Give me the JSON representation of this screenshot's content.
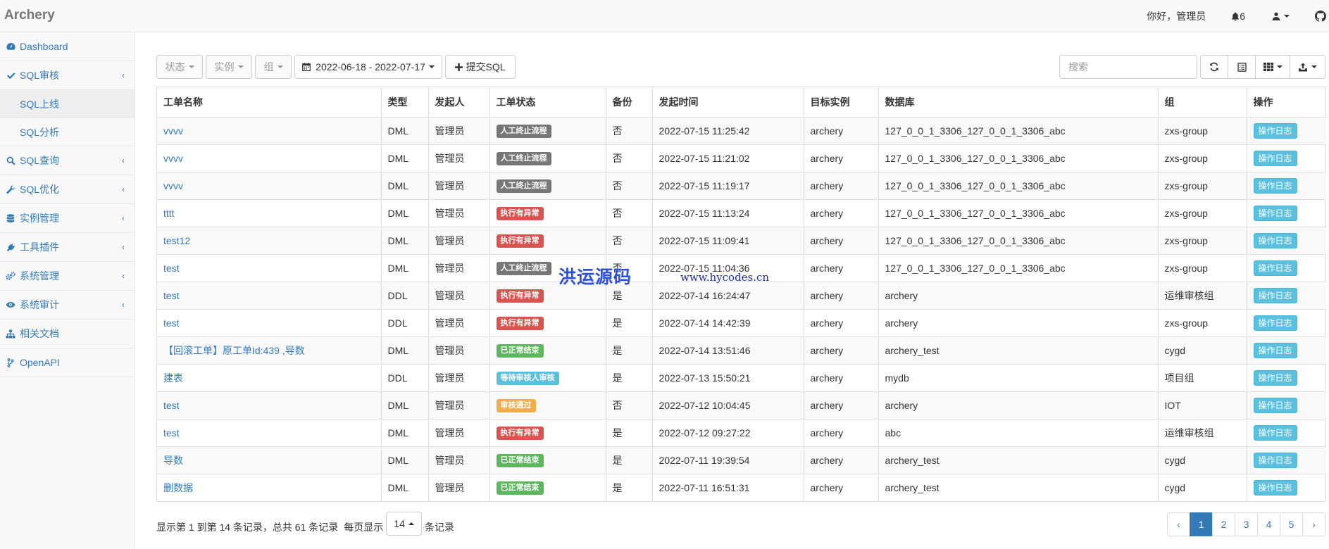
{
  "navbar": {
    "brand": "Archery",
    "greeting": "你好，管理员",
    "notification_count": "6"
  },
  "sidebar": {
    "items": [
      {
        "label": "Dashboard",
        "icon": "dashboard-icon"
      },
      {
        "label": "SQL审核",
        "icon": "check-icon",
        "children": [
          {
            "label": "SQL上线",
            "active": true
          },
          {
            "label": "SQL分析",
            "active": false
          }
        ]
      },
      {
        "label": "SQL查询",
        "icon": "search-icon"
      },
      {
        "label": "SQL优化",
        "icon": "wrench-icon"
      },
      {
        "label": "实例管理",
        "icon": "database-icon"
      },
      {
        "label": "工具插件",
        "icon": "plug-icon"
      },
      {
        "label": "系统管理",
        "icon": "gears-icon"
      },
      {
        "label": "系统审计",
        "icon": "eye-icon"
      },
      {
        "label": "相关文档",
        "icon": "sitemap-icon"
      },
      {
        "label": "OpenAPI",
        "icon": "code-fork-icon"
      }
    ]
  },
  "toolbar": {
    "status_filter": "状态",
    "instance_filter": "实例",
    "group_filter": "组",
    "date_range": "2022-06-18 - 2022-07-17",
    "submit_label": "提交SQL",
    "search_placeholder": "搜索"
  },
  "table": {
    "columns": [
      "工单名称",
      "类型",
      "发起人",
      "工单状态",
      "备份",
      "发起时间",
      "目标实例",
      "数据库",
      "组",
      "操作"
    ],
    "rows": [
      {
        "name": "vvvv",
        "type": "DML",
        "user": "管理员",
        "status": "人工终止流程",
        "status_color": "#777777",
        "backup": "否",
        "time": "2022-07-15 11:25:42",
        "instance": "archery",
        "db": "127_0_0_1_3306_127_0_0_1_3306_abc",
        "group": "zxs-group",
        "action": "操作日志"
      },
      {
        "name": "vvvv",
        "type": "DML",
        "user": "管理员",
        "status": "人工终止流程",
        "status_color": "#777777",
        "backup": "否",
        "time": "2022-07-15 11:21:02",
        "instance": "archery",
        "db": "127_0_0_1_3306_127_0_0_1_3306_abc",
        "group": "zxs-group",
        "action": "操作日志"
      },
      {
        "name": "vvvv",
        "type": "DML",
        "user": "管理员",
        "status": "人工终止流程",
        "status_color": "#777777",
        "backup": "否",
        "time": "2022-07-15 11:19:17",
        "instance": "archery",
        "db": "127_0_0_1_3306_127_0_0_1_3306_abc",
        "group": "zxs-group",
        "action": "操作日志"
      },
      {
        "name": "tttt",
        "type": "DML",
        "user": "管理员",
        "status": "执行有异常",
        "status_color": "#d9534f",
        "backup": "否",
        "time": "2022-07-15 11:13:24",
        "instance": "archery",
        "db": "127_0_0_1_3306_127_0_0_1_3306_abc",
        "group": "zxs-group",
        "action": "操作日志"
      },
      {
        "name": "test12",
        "type": "DML",
        "user": "管理员",
        "status": "执行有异常",
        "status_color": "#d9534f",
        "backup": "否",
        "time": "2022-07-15 11:09:41",
        "instance": "archery",
        "db": "127_0_0_1_3306_127_0_0_1_3306_abc",
        "group": "zxs-group",
        "action": "操作日志"
      },
      {
        "name": "test",
        "type": "DML",
        "user": "管理员",
        "status": "人工终止流程",
        "status_color": "#777777",
        "backup": "否",
        "time": "2022-07-15 11:04:36",
        "instance": "archery",
        "db": "127_0_0_1_3306_127_0_0_1_3306_abc",
        "group": "zxs-group",
        "action": "操作日志"
      },
      {
        "name": "test",
        "type": "DDL",
        "user": "管理员",
        "status": "执行有异常",
        "status_color": "#d9534f",
        "backup": "是",
        "time": "2022-07-14 16:24:47",
        "instance": "archery",
        "db": "archery",
        "group": "运维审核组",
        "action": "操作日志"
      },
      {
        "name": "test",
        "type": "DDL",
        "user": "管理员",
        "status": "执行有异常",
        "status_color": "#d9534f",
        "backup": "是",
        "time": "2022-07-14 14:42:39",
        "instance": "archery",
        "db": "archery",
        "group": "zxs-group",
        "action": "操作日志"
      },
      {
        "name": "【回滚工单】原工单Id:439 ,导数",
        "type": "DML",
        "user": "管理员",
        "status": "已正常结束",
        "status_color": "#5cb85c",
        "backup": "是",
        "time": "2022-07-14 13:51:46",
        "instance": "archery",
        "db": "archery_test",
        "group": "cygd",
        "action": "操作日志"
      },
      {
        "name": "建表",
        "type": "DDL",
        "user": "管理员",
        "status": "等待审核人审核",
        "status_color": "#5bc0de",
        "backup": "是",
        "time": "2022-07-13 15:50:21",
        "instance": "archery",
        "db": "mydb",
        "group": "项目组",
        "action": "操作日志"
      },
      {
        "name": "test",
        "type": "DML",
        "user": "管理员",
        "status": "审核通过",
        "status_color": "#f0ad4e",
        "backup": "否",
        "time": "2022-07-12 10:04:45",
        "instance": "archery",
        "db": "archery",
        "group": "IOT",
        "action": "操作日志"
      },
      {
        "name": "test",
        "type": "DML",
        "user": "管理员",
        "status": "执行有异常",
        "status_color": "#d9534f",
        "backup": "是",
        "time": "2022-07-12 09:27:22",
        "instance": "archery",
        "db": "abc",
        "group": "运维审核组",
        "action": "操作日志"
      },
      {
        "name": "导数",
        "type": "DML",
        "user": "管理员",
        "status": "已正常结束",
        "status_color": "#5cb85c",
        "backup": "是",
        "time": "2022-07-11 19:39:54",
        "instance": "archery",
        "db": "archery_test",
        "group": "cygd",
        "action": "操作日志"
      },
      {
        "name": "删数据",
        "type": "DML",
        "user": "管理员",
        "status": "已正常结束",
        "status_color": "#5cb85c",
        "backup": "是",
        "time": "2022-07-11 16:51:31",
        "instance": "archery",
        "db": "archery_test",
        "group": "cygd",
        "action": "操作日志"
      }
    ]
  },
  "footer": {
    "summary": "显示第 1 到第 14 条记录，总共 61 条记录",
    "per_page_prefix": "每页显示",
    "per_page_value": "14",
    "per_page_suffix": "条记录",
    "pages": [
      "‹",
      "1",
      "2",
      "3",
      "4",
      "5",
      "›"
    ],
    "active_page": "1"
  },
  "watermark": {
    "cn": "洪运源码",
    "url": "www.hycodes.cn"
  },
  "colors": {
    "link": "#337ab7",
    "info": "#5bc0de"
  }
}
